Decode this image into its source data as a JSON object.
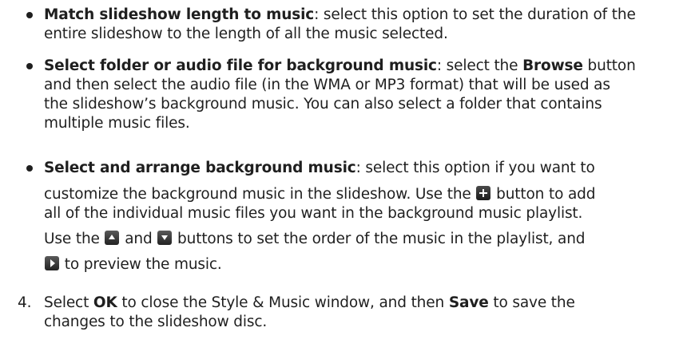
{
  "bullets": [
    {
      "title": "Match slideshow length to music",
      "line1_rest": ": select this option to set the duration of the",
      "line2": "entire slideshow to the length of all the music selected."
    },
    {
      "title": "Select folder or audio file for background music",
      "line1_mid": ": select the ",
      "line1_bold2": "Browse",
      "line1_end": " button",
      "line2": "and then select the audio file (in the WMA or MP3 format) that will be used as",
      "line3": "the slideshow’s background music. You can also select a folder that contains",
      "line4": "multiple music files."
    },
    {
      "title": "Select and arrange background music",
      "line1_rest": ": select this option if you want to",
      "line2a": "customize the background music in the slideshow. Use the ",
      "line2b": " button to add",
      "line3": "all of the individual music files you want in the background music playlist.",
      "line4a": "Use the ",
      "line4b": " and ",
      "line4c": " buttons to set the order of the music in the playlist, and",
      "line5": " to preview the music."
    }
  ],
  "step": {
    "number": "4.",
    "line1a": "Select ",
    "line1b": "OK",
    "line1c": " to close the Style & Music window, and then ",
    "line1d": "Save",
    "line1e": " to save the",
    "line2": "changes to the slideshow disc."
  },
  "icons": [
    "plus-icon",
    "arrow-up-icon",
    "arrow-down-icon",
    "play-icon"
  ]
}
